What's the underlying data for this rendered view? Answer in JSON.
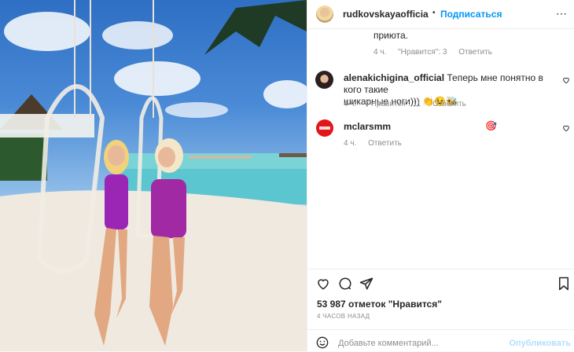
{
  "photo": {
    "description": ""
  },
  "header": {
    "username": "rudkovskayaofficia",
    "separator": "•",
    "follow_label": "Подписаться",
    "more": "⋯"
  },
  "comments": [
    {
      "text": "приюта.",
      "time": "4 ч.",
      "likes": "\"Нравится\": 3",
      "reply": "Ответить"
    },
    {
      "username": "alenakichigina_official",
      "text_line1": "Теперь мне понятно в кого такие",
      "text_line2": "шикарные ноги)))",
      "emojis": "👏😉🐝",
      "time": "4 ч.",
      "likes": "\"Нравится\": 11",
      "reply": "Ответить"
    },
    {
      "username": "mclarsmm",
      "emoji": "🎯",
      "time": "4 ч.",
      "reply": "Ответить"
    }
  ],
  "likes_count": "53 987 отметок \"Нравится\"",
  "posted": "4 ЧАСОВ НАЗАД",
  "add_comment": {
    "placeholder": "Добавьте комментарий...",
    "publish": "Опубликовать"
  },
  "colors": {
    "accent": "#0095f6",
    "muted": "#8e8e8e",
    "publish_disabled": "#b2dffc"
  }
}
